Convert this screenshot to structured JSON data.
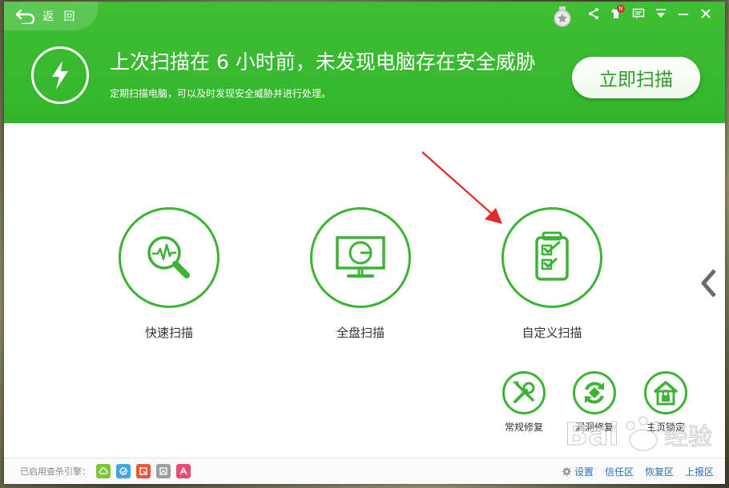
{
  "header": {
    "back_label": "返 回",
    "headline": "上次扫描在 6 小时前，未发现电脑存在安全威胁",
    "subline": "定期扫描电脑，可以及时发现安全威胁并进行处理。",
    "scan_now_label": "立即扫描",
    "top_icons": [
      "share-icon",
      "shirt-icon",
      "message-icon",
      "menu-icon",
      "minimize-icon",
      "close-icon"
    ],
    "badge": "N"
  },
  "scan_options": [
    {
      "label": "快速扫描",
      "icon": "magnifier-pulse-icon"
    },
    {
      "label": "全盘扫描",
      "icon": "monitor-icon"
    },
    {
      "label": "自定义扫描",
      "icon": "checklist-icon"
    }
  ],
  "tools": [
    {
      "label": "常规修复",
      "icon": "wrench-screwdriver-icon"
    },
    {
      "label": "漏洞修复",
      "icon": "refresh-patch-icon"
    },
    {
      "label": "主页锁定",
      "icon": "home-lock-icon"
    }
  ],
  "footer": {
    "engines_label": "已启用查杀引擎：",
    "engines": [
      {
        "icon": "cloud-icon",
        "color": "#7cc63b"
      },
      {
        "icon": "engine-swirl-icon",
        "color": "#3ba7e6"
      },
      {
        "icon": "engine-q-icon",
        "color": "#e8583c"
      },
      {
        "icon": "engine-image-icon",
        "color": "#9e9e9e"
      },
      {
        "icon": "engine-a-icon",
        "color": "#ea4d74"
      }
    ],
    "links": {
      "settings": "设置",
      "trust": "信任区",
      "restore": "恢复区",
      "report": "上报区"
    }
  },
  "watermark": "Bai 经验",
  "colors": {
    "brand_green": "#3ebf34",
    "ring_green": "#3cb335",
    "link_blue": "#2a6fb8",
    "annotation_red": "#e02a2a"
  }
}
